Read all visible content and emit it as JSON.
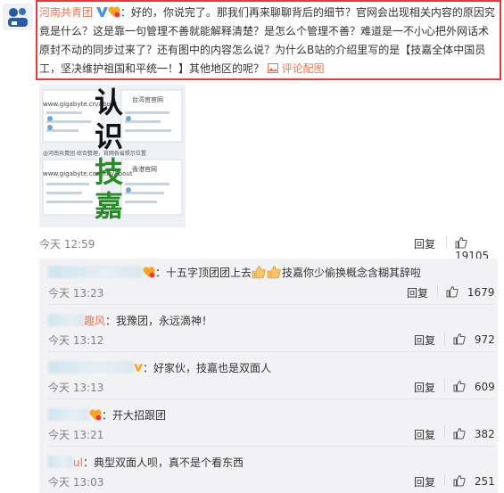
{
  "main_comment": {
    "username": "河南共青团",
    "text": "：好的，你说完了。那我们再来聊聊背后的细节？官网会出现相关内容的原因究竟是什么？这是靠一句管理不善就能解释清楚？是怎么个管理不善？难道是一不小心把外网话术原封不动的同步过来了？还有图中的内容怎么说？为什么B站的介绍里写的是【技嘉全体中国员工，坚决维护祖国和平统一！】其他地区的呢？",
    "link_text": "评论配图",
    "time": "今天 12:59",
    "reply_label": "回复",
    "likes": "19105",
    "image": {
      "big_chars": [
        "认",
        "识",
        "技",
        "嘉"
      ],
      "url_lines": [
        "www.gigabyte.cn/About",
        "www.gigabyte.com/hk/About"
      ],
      "side_labels": [
        "台湾官官网",
        "香港官网"
      ],
      "caption": "@河南共青团 综合整理，官网各省照示位置"
    }
  },
  "replies": [
    {
      "name_suffix": "",
      "text": "：十五字顶团团上去",
      "text2": "技嘉你少偷换概念含糊其辞啦",
      "time": "今天 13:23",
      "reply_label": "回复",
      "likes": "1679"
    },
    {
      "name_suffix": "趣风",
      "text": "：我豫团，永远滴神！",
      "time": "今天 13:12",
      "reply_label": "回复",
      "likes": "972"
    },
    {
      "name_suffix": "V",
      "text": "：好家伙，技嘉也是双面人",
      "time": "今天 13:13",
      "reply_label": "回复",
      "likes": "609"
    },
    {
      "name_suffix": "",
      "text": "：开大招跟团",
      "time": "今天 13:21",
      "reply_label": "回复",
      "likes": "382"
    },
    {
      "name_suffix": "ul",
      "text": "：典型双面人呗，真不是个看东西",
      "time": "今天 13:03",
      "reply_label": "回复",
      "likes": "251"
    }
  ]
}
